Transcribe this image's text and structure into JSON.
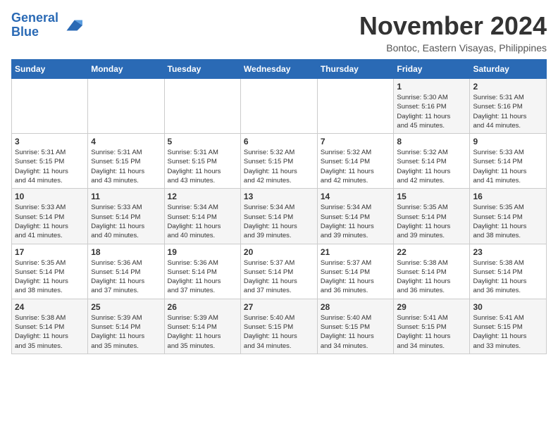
{
  "header": {
    "logo_line1": "General",
    "logo_line2": "Blue",
    "month": "November 2024",
    "location": "Bontoc, Eastern Visayas, Philippines"
  },
  "weekdays": [
    "Sunday",
    "Monday",
    "Tuesday",
    "Wednesday",
    "Thursday",
    "Friday",
    "Saturday"
  ],
  "weeks": [
    [
      {
        "day": "",
        "info": ""
      },
      {
        "day": "",
        "info": ""
      },
      {
        "day": "",
        "info": ""
      },
      {
        "day": "",
        "info": ""
      },
      {
        "day": "",
        "info": ""
      },
      {
        "day": "1",
        "info": "Sunrise: 5:30 AM\nSunset: 5:16 PM\nDaylight: 11 hours\nand 45 minutes."
      },
      {
        "day": "2",
        "info": "Sunrise: 5:31 AM\nSunset: 5:16 PM\nDaylight: 11 hours\nand 44 minutes."
      }
    ],
    [
      {
        "day": "3",
        "info": "Sunrise: 5:31 AM\nSunset: 5:15 PM\nDaylight: 11 hours\nand 44 minutes."
      },
      {
        "day": "4",
        "info": "Sunrise: 5:31 AM\nSunset: 5:15 PM\nDaylight: 11 hours\nand 43 minutes."
      },
      {
        "day": "5",
        "info": "Sunrise: 5:31 AM\nSunset: 5:15 PM\nDaylight: 11 hours\nand 43 minutes."
      },
      {
        "day": "6",
        "info": "Sunrise: 5:32 AM\nSunset: 5:15 PM\nDaylight: 11 hours\nand 42 minutes."
      },
      {
        "day": "7",
        "info": "Sunrise: 5:32 AM\nSunset: 5:14 PM\nDaylight: 11 hours\nand 42 minutes."
      },
      {
        "day": "8",
        "info": "Sunrise: 5:32 AM\nSunset: 5:14 PM\nDaylight: 11 hours\nand 42 minutes."
      },
      {
        "day": "9",
        "info": "Sunrise: 5:33 AM\nSunset: 5:14 PM\nDaylight: 11 hours\nand 41 minutes."
      }
    ],
    [
      {
        "day": "10",
        "info": "Sunrise: 5:33 AM\nSunset: 5:14 PM\nDaylight: 11 hours\nand 41 minutes."
      },
      {
        "day": "11",
        "info": "Sunrise: 5:33 AM\nSunset: 5:14 PM\nDaylight: 11 hours\nand 40 minutes."
      },
      {
        "day": "12",
        "info": "Sunrise: 5:34 AM\nSunset: 5:14 PM\nDaylight: 11 hours\nand 40 minutes."
      },
      {
        "day": "13",
        "info": "Sunrise: 5:34 AM\nSunset: 5:14 PM\nDaylight: 11 hours\nand 39 minutes."
      },
      {
        "day": "14",
        "info": "Sunrise: 5:34 AM\nSunset: 5:14 PM\nDaylight: 11 hours\nand 39 minutes."
      },
      {
        "day": "15",
        "info": "Sunrise: 5:35 AM\nSunset: 5:14 PM\nDaylight: 11 hours\nand 39 minutes."
      },
      {
        "day": "16",
        "info": "Sunrise: 5:35 AM\nSunset: 5:14 PM\nDaylight: 11 hours\nand 38 minutes."
      }
    ],
    [
      {
        "day": "17",
        "info": "Sunrise: 5:35 AM\nSunset: 5:14 PM\nDaylight: 11 hours\nand 38 minutes."
      },
      {
        "day": "18",
        "info": "Sunrise: 5:36 AM\nSunset: 5:14 PM\nDaylight: 11 hours\nand 37 minutes."
      },
      {
        "day": "19",
        "info": "Sunrise: 5:36 AM\nSunset: 5:14 PM\nDaylight: 11 hours\nand 37 minutes."
      },
      {
        "day": "20",
        "info": "Sunrise: 5:37 AM\nSunset: 5:14 PM\nDaylight: 11 hours\nand 37 minutes."
      },
      {
        "day": "21",
        "info": "Sunrise: 5:37 AM\nSunset: 5:14 PM\nDaylight: 11 hours\nand 36 minutes."
      },
      {
        "day": "22",
        "info": "Sunrise: 5:38 AM\nSunset: 5:14 PM\nDaylight: 11 hours\nand 36 minutes."
      },
      {
        "day": "23",
        "info": "Sunrise: 5:38 AM\nSunset: 5:14 PM\nDaylight: 11 hours\nand 36 minutes."
      }
    ],
    [
      {
        "day": "24",
        "info": "Sunrise: 5:38 AM\nSunset: 5:14 PM\nDaylight: 11 hours\nand 35 minutes."
      },
      {
        "day": "25",
        "info": "Sunrise: 5:39 AM\nSunset: 5:14 PM\nDaylight: 11 hours\nand 35 minutes."
      },
      {
        "day": "26",
        "info": "Sunrise: 5:39 AM\nSunset: 5:14 PM\nDaylight: 11 hours\nand 35 minutes."
      },
      {
        "day": "27",
        "info": "Sunrise: 5:40 AM\nSunset: 5:15 PM\nDaylight: 11 hours\nand 34 minutes."
      },
      {
        "day": "28",
        "info": "Sunrise: 5:40 AM\nSunset: 5:15 PM\nDaylight: 11 hours\nand 34 minutes."
      },
      {
        "day": "29",
        "info": "Sunrise: 5:41 AM\nSunset: 5:15 PM\nDaylight: 11 hours\nand 34 minutes."
      },
      {
        "day": "30",
        "info": "Sunrise: 5:41 AM\nSunset: 5:15 PM\nDaylight: 11 hours\nand 33 minutes."
      }
    ]
  ]
}
